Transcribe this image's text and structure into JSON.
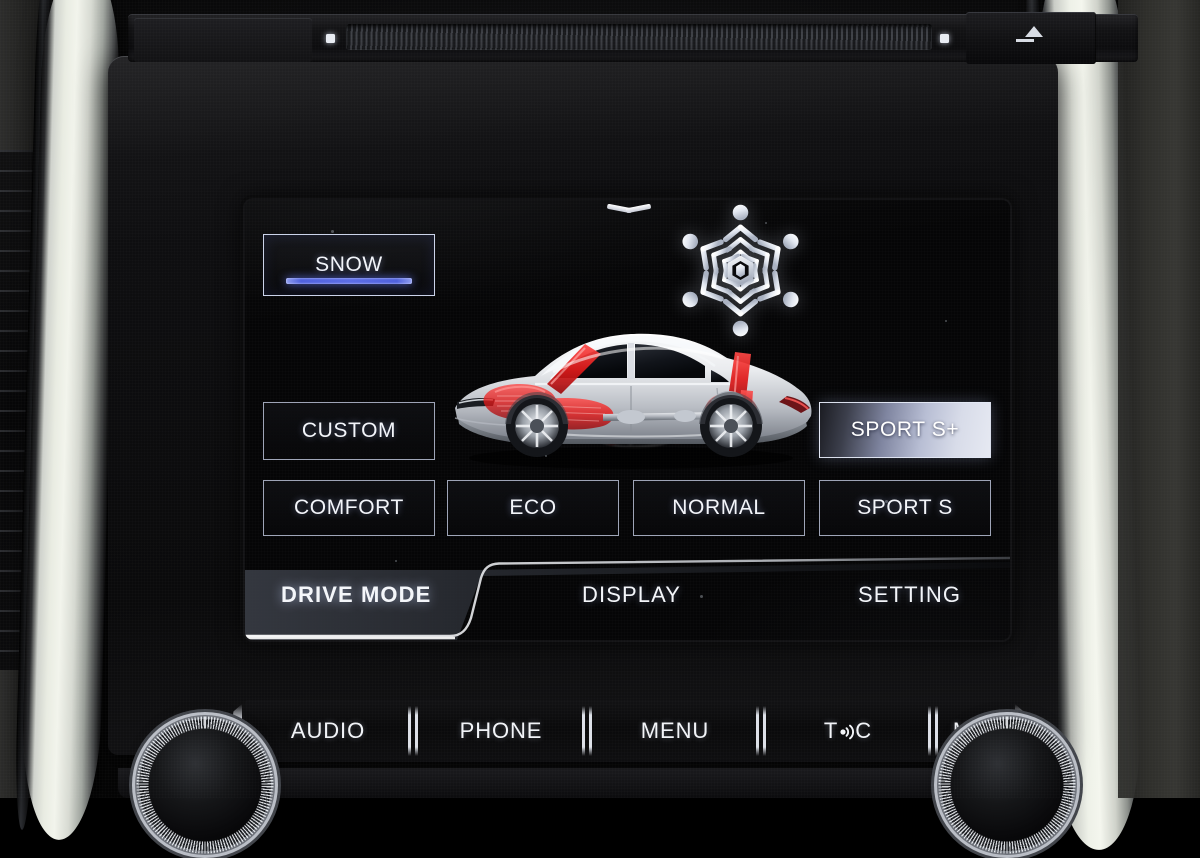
{
  "head_unit": {
    "disc_slot": {
      "name": "CD / DVD disc slot",
      "eject_label": "eject",
      "led_left": "indicator",
      "led_right": "indicator"
    }
  },
  "screen": {
    "pull_handle": "chevron-down",
    "graphics": {
      "snowflake": "snowflake-icon",
      "vehicle": "sedan-side-view-drivetrain"
    },
    "drive_modes": [
      {
        "id": "snow",
        "label": "SNOW",
        "state": "active",
        "has_underline": true
      },
      {
        "id": "custom",
        "label": "CUSTOM",
        "state": "normal",
        "has_underline": false
      },
      {
        "id": "comfort",
        "label": "COMFORT",
        "state": "normal",
        "has_underline": false
      },
      {
        "id": "eco",
        "label": "ECO",
        "state": "normal",
        "has_underline": false
      },
      {
        "id": "normal",
        "label": "NORMAL",
        "state": "normal",
        "has_underline": false
      },
      {
        "id": "sport-s-plus",
        "label": "SPORT S+",
        "state": "selected",
        "has_underline": false
      },
      {
        "id": "sport-s",
        "label": "SPORT S",
        "state": "normal",
        "has_underline": false
      }
    ],
    "tabs": [
      {
        "id": "drive-mode",
        "label": "DRIVE MODE",
        "active": true
      },
      {
        "id": "display",
        "label": "DISPLAY",
        "active": false
      },
      {
        "id": "setting",
        "label": "SETTING",
        "active": false
      }
    ]
  },
  "hardware_buttons": [
    {
      "id": "audio",
      "label": "AUDIO"
    },
    {
      "id": "phone",
      "label": "PHONE"
    },
    {
      "id": "menu",
      "label": "MENU"
    },
    {
      "id": "t-connect",
      "label": "T",
      "label_suffix": "C",
      "icon": "signal-wave-icon"
    },
    {
      "id": "map",
      "label": "MAP"
    }
  ],
  "knobs": [
    {
      "id": "power-volume",
      "name": "power-volume-knob"
    },
    {
      "id": "tune-scroll",
      "name": "tune-scroll-knob"
    }
  ],
  "colors": {
    "accent_blue": "#5a6be6",
    "screen_bg": "#050506",
    "text": "#f3f5fa",
    "button_border": "#c4cce2",
    "highlight_fill": "#e6e9f2"
  }
}
